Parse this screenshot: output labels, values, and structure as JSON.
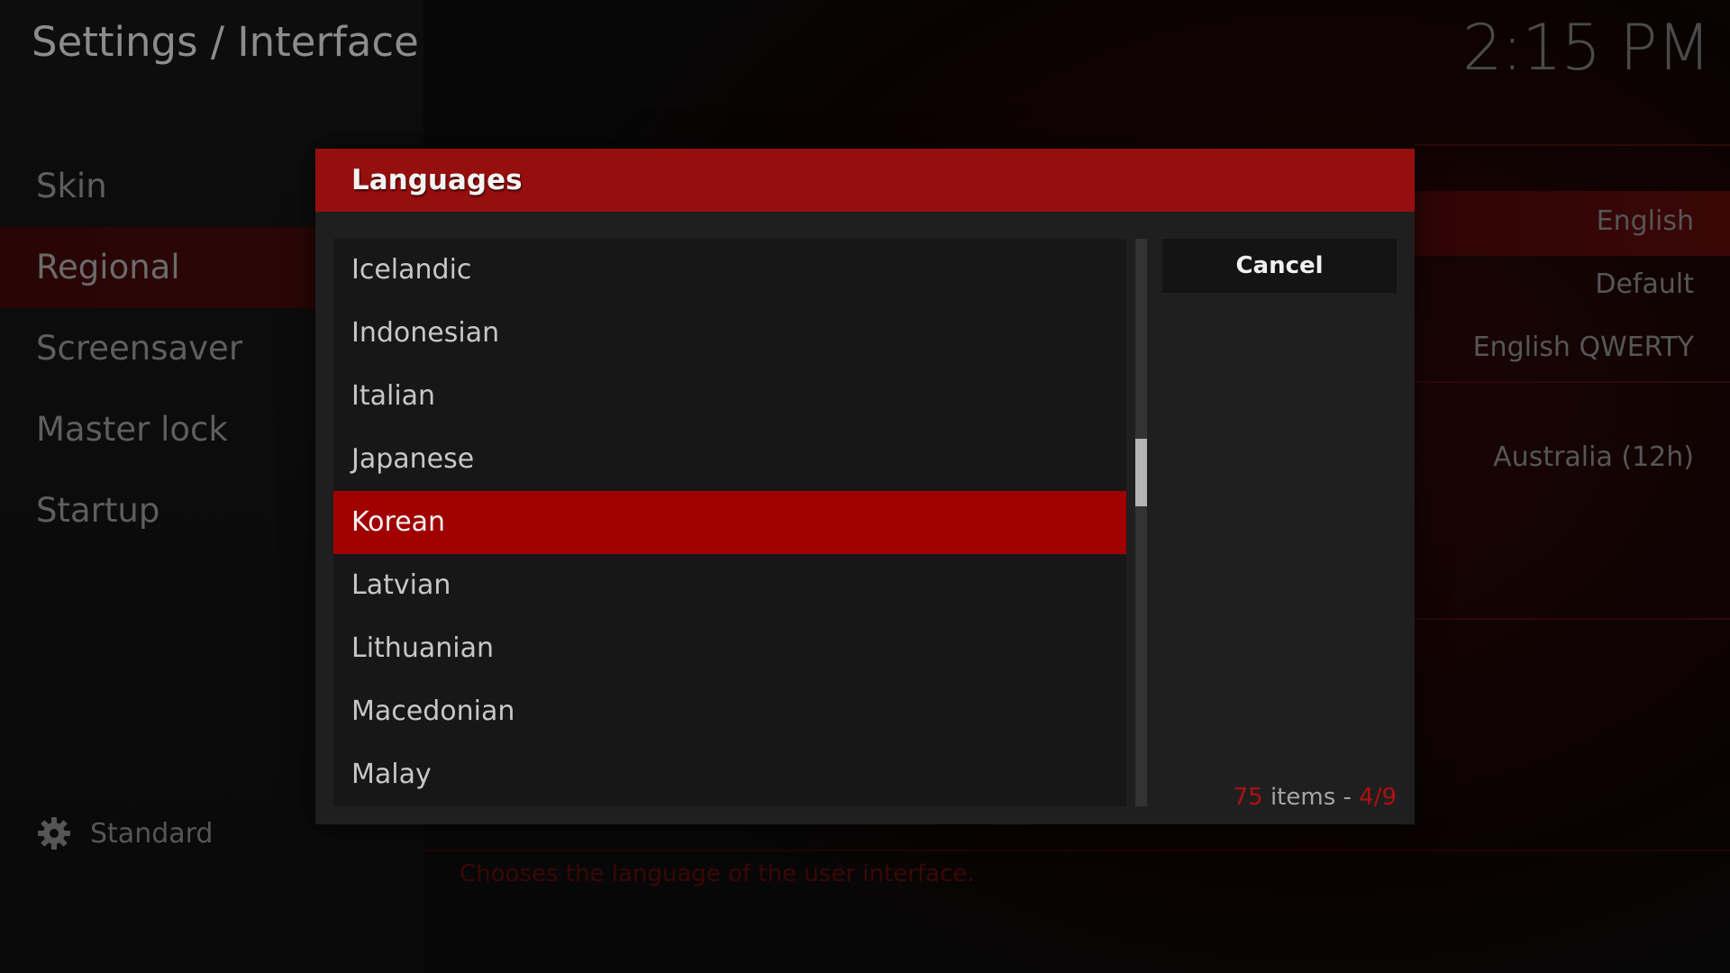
{
  "header": {
    "title": "Settings / Interface",
    "clock": "2:15 PM"
  },
  "sidebar": {
    "items": [
      {
        "label": "Skin"
      },
      {
        "label": "Regional"
      },
      {
        "label": "Screensaver"
      },
      {
        "label": "Master lock"
      },
      {
        "label": "Startup"
      }
    ],
    "selected_index": 1,
    "settings_level": "Standard",
    "settings_level_icon": "gear-icon"
  },
  "background_settings": {
    "values": [
      {
        "label": "English"
      },
      {
        "label": "Default"
      },
      {
        "label": "English QWERTY"
      },
      {
        "label": "Australia (12h)"
      }
    ],
    "description": "Chooses the language of the user interface."
  },
  "dialog": {
    "title": "Languages",
    "cancel_label": "Cancel",
    "items": [
      {
        "label": "Icelandic"
      },
      {
        "label": "Indonesian"
      },
      {
        "label": "Italian"
      },
      {
        "label": "Japanese"
      },
      {
        "label": "Korean"
      },
      {
        "label": "Latvian"
      },
      {
        "label": "Lithuanian"
      },
      {
        "label": "Macedonian"
      },
      {
        "label": "Malay"
      }
    ],
    "selected_index": 4,
    "item_count": "75",
    "items_word": " items - ",
    "page": "4/9",
    "scroll_position": 0.4
  },
  "colors": {
    "accent": "#a00000",
    "header_red": "#950f0f",
    "count_accent": "#b01010"
  }
}
